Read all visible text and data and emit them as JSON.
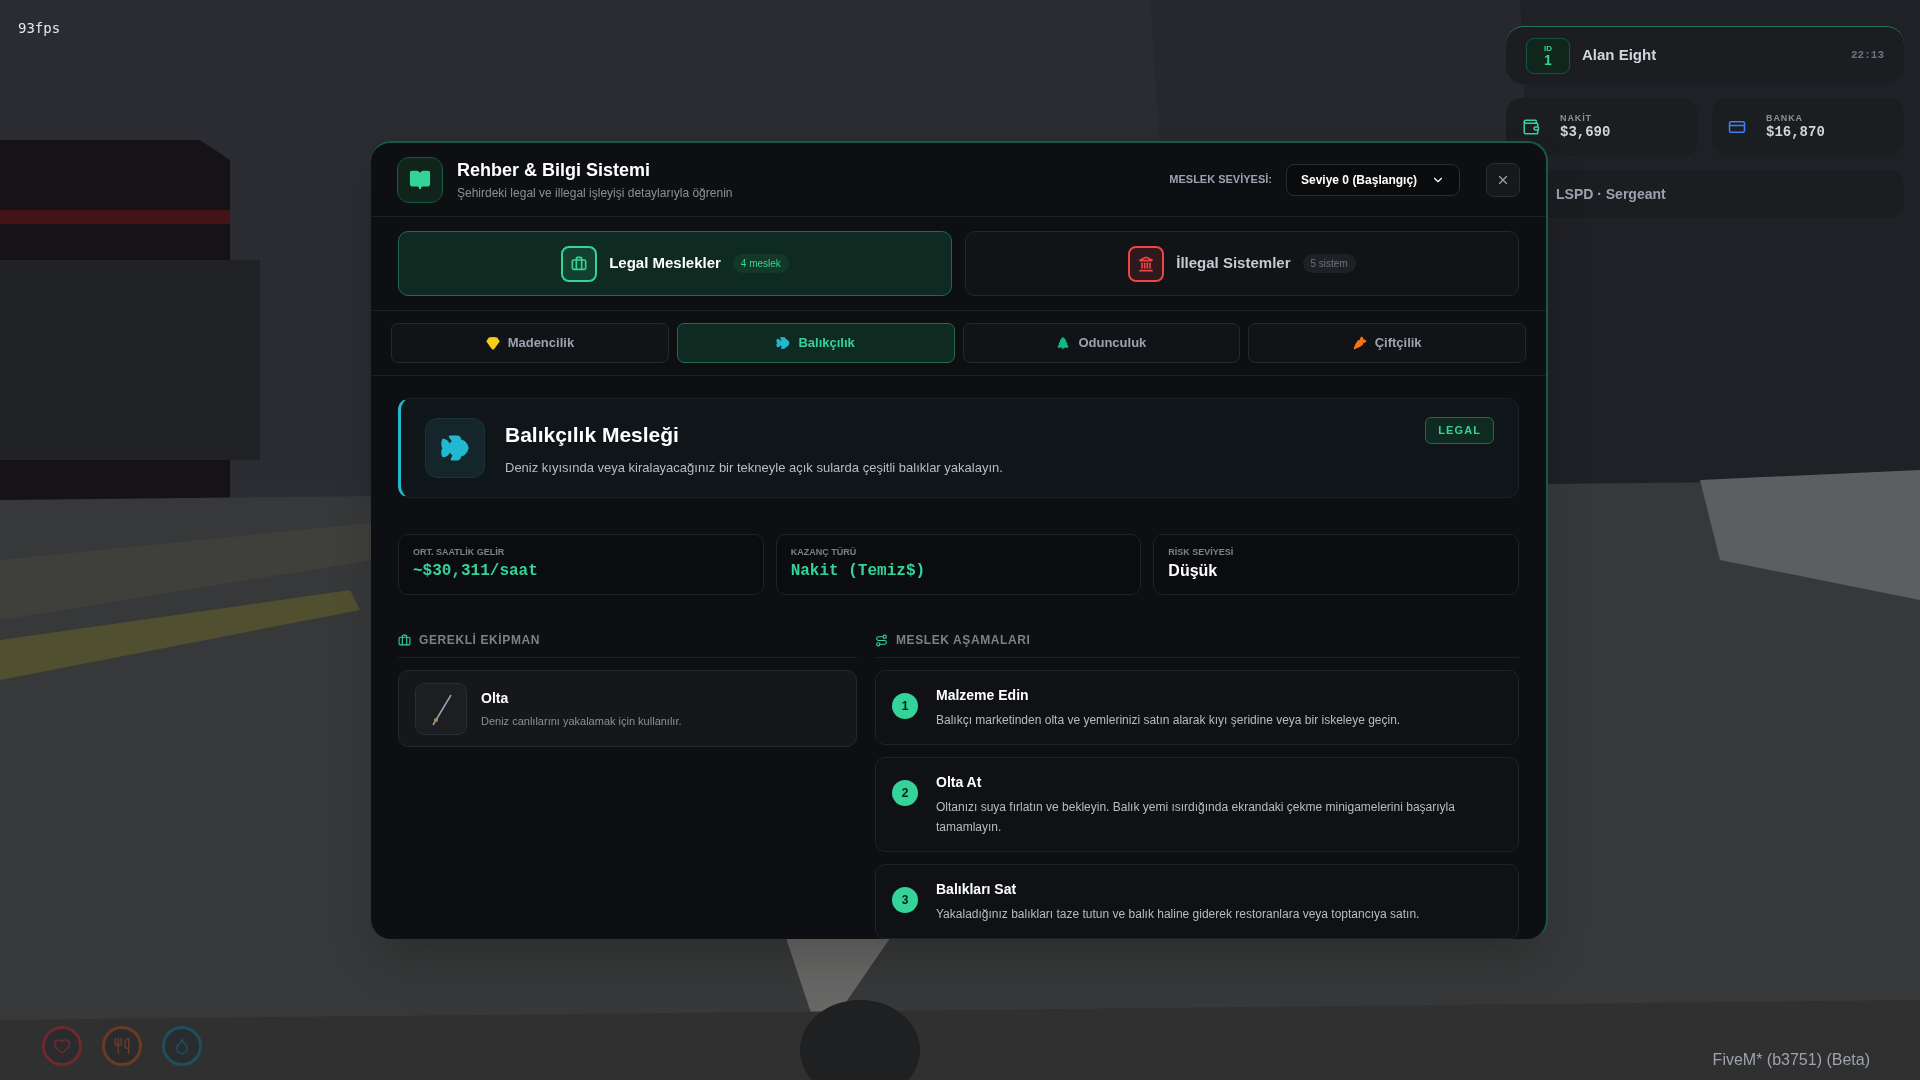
{
  "overlay": {
    "fps": "93fps",
    "version": "FiveM* (b3751) (Beta)"
  },
  "player_hud": {
    "id_label": "ID",
    "id": "1",
    "name": "Alan Eight",
    "time": "22:13",
    "cash_label": "NAKİT",
    "cash": "$3,690",
    "bank_label": "BANKA",
    "bank": "$16,870",
    "job": "LSPD · Sergeant"
  },
  "status_icons": [
    {
      "color": "#6b2a2e"
    },
    {
      "color": "#6b3a22"
    },
    {
      "color": "#1e4f5c"
    }
  ],
  "window": {
    "title": "Rehber & Bilgi Sistemi",
    "subtitle": "Şehirdeki legal ve illegal işleyişi detaylarıyla öğrenin",
    "level_label": "MESLEK SEVİYESİ:",
    "level_value": "Seviye 0 (Başlangıç)"
  },
  "category_tabs": [
    {
      "label": "Legal Meslekler",
      "badge": "4 meslek",
      "selected": true,
      "color": "#34d399"
    },
    {
      "label": "İllegal Sistemler",
      "badge": "5 sistem",
      "selected": false,
      "color": "#ef4444"
    }
  ],
  "job_tabs": [
    {
      "label": "Madencilik",
      "selected": false,
      "color": "#facc15"
    },
    {
      "label": "Balıkçılık",
      "selected": true,
      "color": "#22b8cf"
    },
    {
      "label": "Odunculuk",
      "selected": false,
      "color": "#10b981"
    },
    {
      "label": "Çiftçilik",
      "selected": false,
      "color": "#f97316"
    }
  ],
  "job": {
    "title": "Balıkçılık Mesleği",
    "description": "Deniz kıyısında veya kiralayacağınız bir tekneyle açık sularda çeşitli balıklar yakalayın.",
    "tag": "LEGAL"
  },
  "stats": [
    {
      "label": "ORT. SAATLİK GELİR",
      "value": "~$30,311/saat",
      "highlight": true
    },
    {
      "label": "KAZANÇ TÜRÜ",
      "value": "Nakit (Temiz$)",
      "highlight": true
    },
    {
      "label": "RİSK SEVİYESİ",
      "value": "Düşük",
      "highlight": false
    }
  ],
  "equipment": {
    "heading": "GEREKLİ EKİPMAN",
    "items": [
      {
        "name": "Olta",
        "description": "Deniz canlılarını yakalamak için kullanılır."
      }
    ]
  },
  "steps": {
    "heading": "MESLEK AŞAMALARI",
    "items": [
      {
        "number": "1",
        "title": "Malzeme Edin",
        "description": "Balıkçı marketinden olta ve yemlerinizi satın alarak kıyı şeridine veya bir iskeleye geçin."
      },
      {
        "number": "2",
        "title": "Olta At",
        "description": "Oltanızı suya fırlatın ve bekleyin. Balık yemi ısırdığında ekrandaki çekme minigamelerini başarıyla tamamlayın."
      },
      {
        "number": "3",
        "title": "Balıkları Sat",
        "description": "Yakaladığınız balıkları taze tutun ve balık haline giderek restoranlara veya toptancıya satın."
      }
    ]
  }
}
